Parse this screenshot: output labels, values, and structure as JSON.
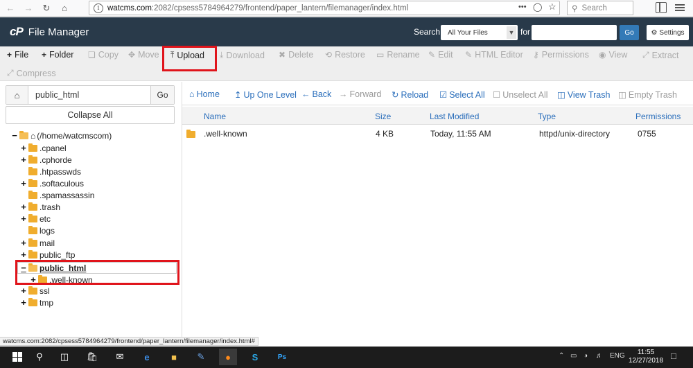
{
  "browser": {
    "url": "watcms.com:2082/cpsess5784964279/frontend/paper_lantern/filemanager/index.html",
    "url_host": "watcms.com",
    "url_path": ":2082/cpsess5784964279/frontend/paper_lantern/filemanager/index.html",
    "more_label": "•••",
    "search_placeholder": "Search"
  },
  "header": {
    "logo": "cP",
    "title": "File Manager",
    "search_label": "Search",
    "scope_selected": "All Your Files",
    "for_label": "for",
    "go_label": "Go",
    "settings_label": "Settings"
  },
  "toolbar": {
    "file": "File",
    "folder": "Folder",
    "copy": "Copy",
    "move": "Move",
    "upload": "Upload",
    "download": "Download",
    "delete": "Delete",
    "restore": "Restore",
    "rename": "Rename",
    "edit": "Edit",
    "html_editor": "HTML Editor",
    "permissions": "Permissions",
    "view": "View",
    "extract": "Extract",
    "compress": "Compress"
  },
  "left": {
    "path_value": "public_html",
    "go_label": "Go",
    "collapse_label": "Collapse All",
    "tree": {
      "root": "(/home/watcmscom)",
      "cpanel": ".cpanel",
      "cphorde": ".cphorde",
      "htpasswds": ".htpasswds",
      "softaculous": ".softaculous",
      "spamassassin": ".spamassassin",
      "trash": ".trash",
      "etc": "etc",
      "logs": "logs",
      "mail": "mail",
      "public_ftp": "public_ftp",
      "public_html": "public_html",
      "well_known": ".well-known",
      "ssl": "ssl",
      "tmp": "tmp"
    }
  },
  "nav": {
    "home": "Home",
    "up": "Up One Level",
    "back": "Back",
    "forward": "Forward",
    "reload": "Reload",
    "select_all": "Select All",
    "unselect_all": "Unselect All",
    "view_trash": "View Trash",
    "empty_trash": "Empty Trash"
  },
  "table": {
    "columns": [
      "Name",
      "Size",
      "Last Modified",
      "Type",
      "Permissions"
    ],
    "rows": [
      {
        "name": ".well-known",
        "size": "4 KB",
        "modified": "Today, 11:55 AM",
        "type": "httpd/unix-directory",
        "perms": "0755"
      }
    ]
  },
  "status_url": "watcms.com:2082/cpsess5784964279/frontend/paper_lantern/filemanager/index.html#",
  "taskbar": {
    "lang": "ENG",
    "time": "11:55",
    "date": "12/27/2018"
  },
  "colors": {
    "header_bg": "#293a4a",
    "link_blue": "#2a6ebb",
    "highlight_red": "#e0141b",
    "folder": "#f0ad2e"
  }
}
